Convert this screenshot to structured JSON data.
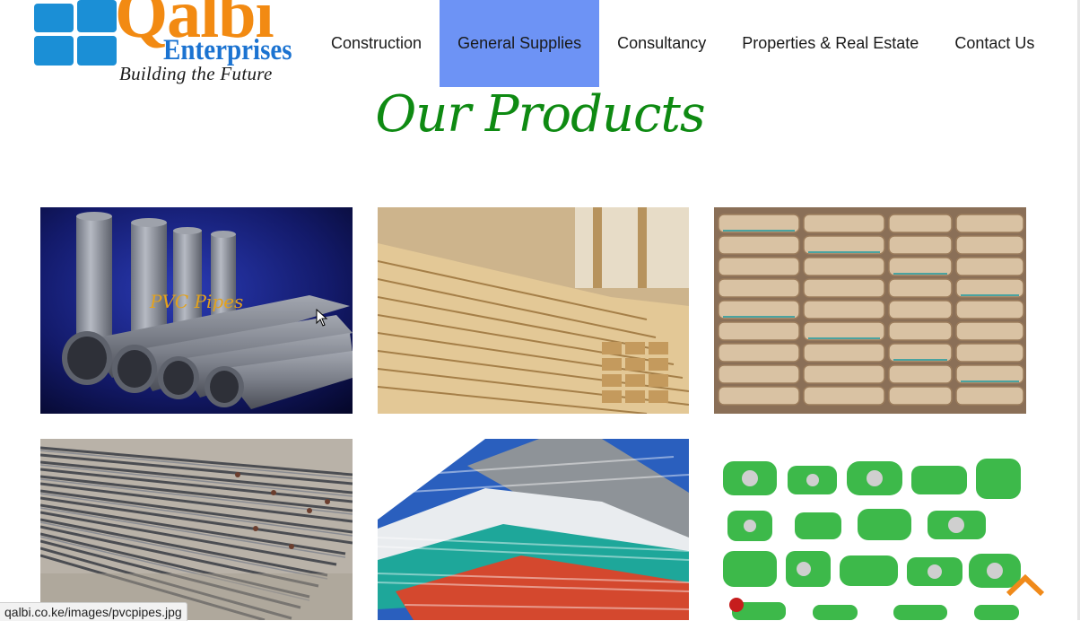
{
  "logo": {
    "name": "Qalbi",
    "sub": "Enterprises",
    "tagline": "Building the Future",
    "colors": {
      "orange": "#f28a12",
      "blue": "#1b8fd6"
    }
  },
  "nav": {
    "items": [
      {
        "label": "Construction",
        "active": false
      },
      {
        "label": "General Supplies",
        "active": true
      },
      {
        "label": "Consultancy",
        "active": false
      },
      {
        "label": "Properties & Real Estate",
        "active": false
      },
      {
        "label": "Contact Us",
        "active": false
      }
    ],
    "active_color": "#6d93f5"
  },
  "section": {
    "title": "Our Products",
    "title_color": "#0e8a12"
  },
  "products": [
    {
      "image": "pvc-pipes",
      "caption": "PVC Pipes"
    },
    {
      "image": "timber-planks"
    },
    {
      "image": "cement-bags"
    },
    {
      "image": "steel-rebar"
    },
    {
      "image": "roofing-sheets"
    },
    {
      "image": "ppr-fittings"
    }
  ],
  "status_bar": {
    "url": "qalbi.co.ke/images/pvcpipes.jpg"
  },
  "back_to_top": {
    "icon": "chevron-up-icon",
    "color": "#f08a1a"
  }
}
